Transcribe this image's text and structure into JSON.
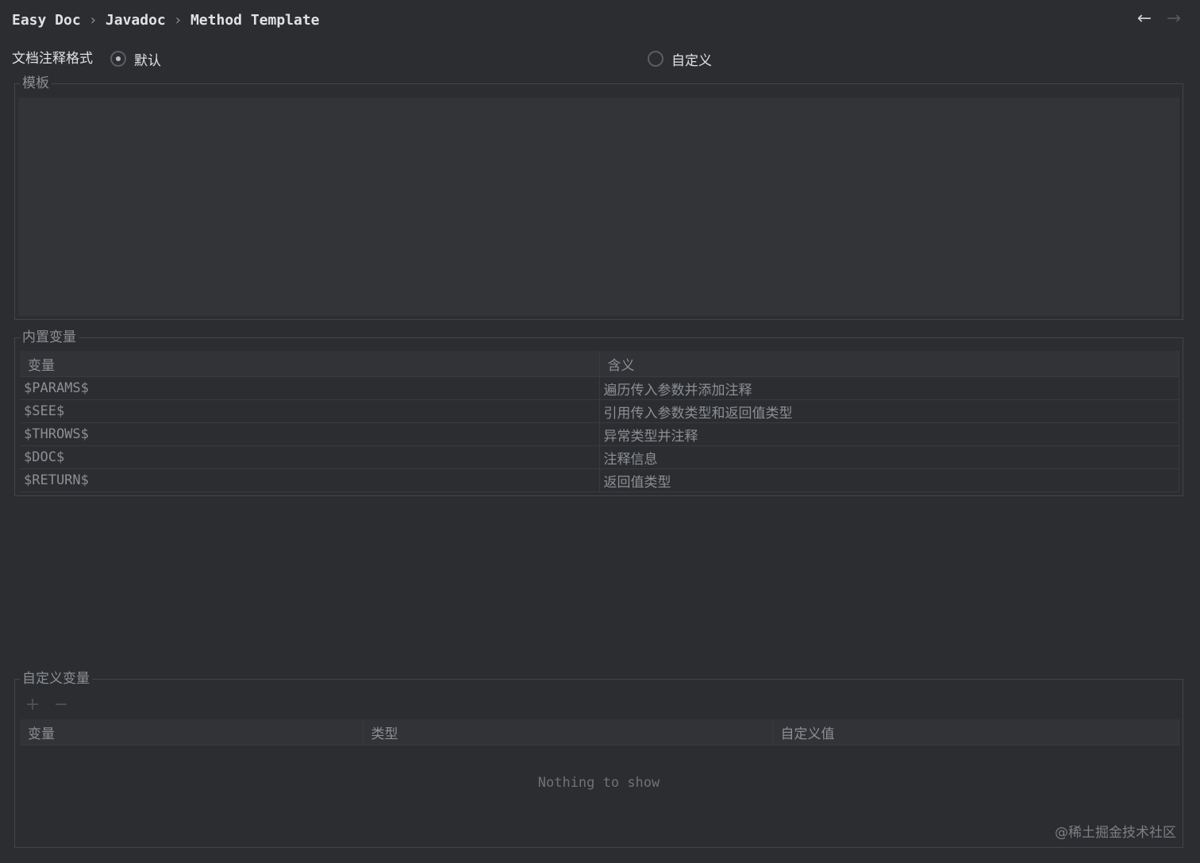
{
  "breadcrumb": {
    "items": [
      "Easy Doc",
      "Javadoc",
      "Method Template"
    ],
    "separator": "›"
  },
  "nav": {
    "back_icon": "←",
    "forward_icon": "→"
  },
  "format": {
    "label": "文档注释格式",
    "options": [
      {
        "label": "默认",
        "checked": true
      },
      {
        "label": "自定义",
        "checked": false
      }
    ]
  },
  "template": {
    "title": "模板",
    "value": ""
  },
  "builtin": {
    "title": "内置变量",
    "columns": [
      "变量",
      "含义"
    ],
    "rows": [
      [
        "$PARAMS$",
        "遍历传入参数并添加注释"
      ],
      [
        "$SEE$",
        "引用传入参数类型和返回值类型"
      ],
      [
        "$THROWS$",
        "异常类型并注释"
      ],
      [
        "$DOC$",
        "注释信息"
      ],
      [
        "$RETURN$",
        "返回值类型"
      ]
    ]
  },
  "custom": {
    "title": "自定义变量",
    "add_icon": "+",
    "remove_icon": "−",
    "columns": [
      "变量",
      "类型",
      "自定义值"
    ],
    "empty_text": "Nothing to show"
  },
  "watermark": "@稀土掘金技术社区"
}
